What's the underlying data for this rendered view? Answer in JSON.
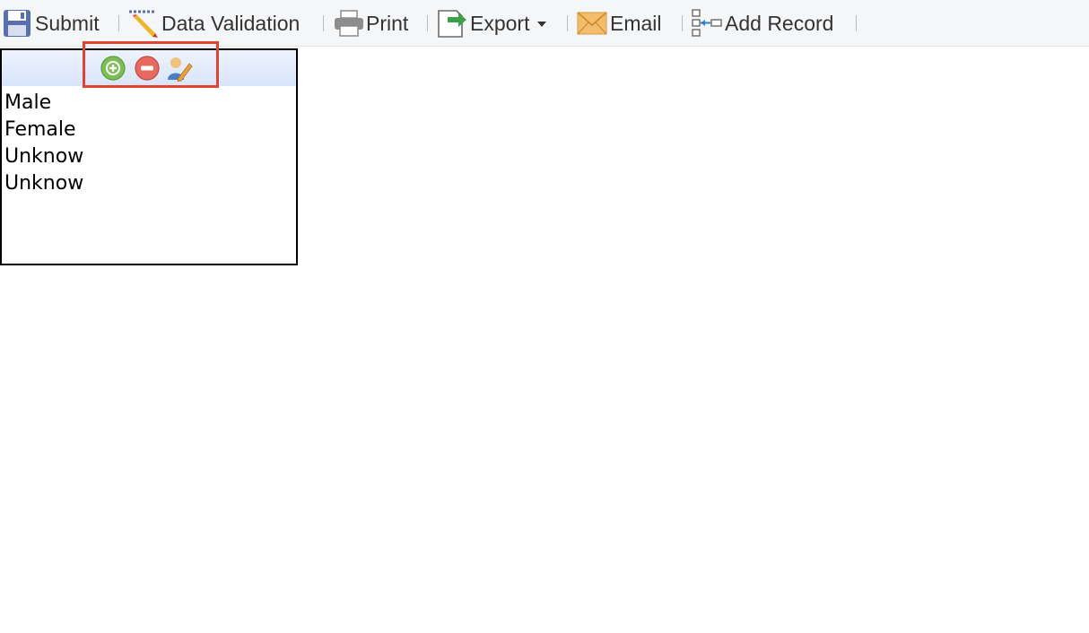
{
  "toolbar": {
    "items": [
      {
        "label": "Submit",
        "icon": "floppy-disk-icon"
      },
      {
        "label": "Data Validation",
        "icon": "ruler-pencil-icon"
      },
      {
        "label": "Print",
        "icon": "printer-icon"
      },
      {
        "label": "Export",
        "icon": "export-document-icon",
        "has_dropdown": true
      },
      {
        "label": "Email",
        "icon": "envelope-icon"
      },
      {
        "label": "Add Record",
        "icon": "add-record-tree-icon"
      }
    ]
  },
  "listbox": {
    "buttons": [
      {
        "icon": "add-plus-icon",
        "color": "#6fb24a"
      },
      {
        "icon": "remove-minus-icon",
        "color": "#e0544b"
      },
      {
        "icon": "edit-user-icon",
        "color": "#e8a33a"
      }
    ],
    "items": [
      "Male",
      "Female",
      "Unknow",
      "Unknow"
    ],
    "highlight_color": "#e0432f"
  }
}
